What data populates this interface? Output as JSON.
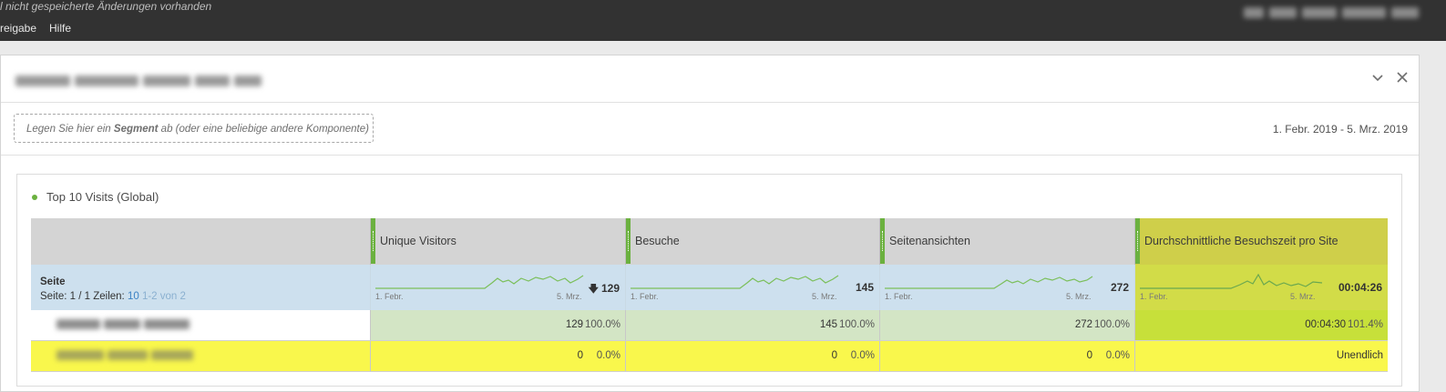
{
  "app": {
    "unsaved_notice": "l nicht gespeicherte Änderungen vorhanden",
    "menu": [
      {
        "label": "reigabe"
      },
      {
        "label": "Hilfe"
      }
    ]
  },
  "panel": {
    "collapse_icon": "chevron-down-icon",
    "close_icon": "close-icon",
    "dropzone": {
      "prefix": "Legen Sie hier ein ",
      "bold": "Segment",
      "suffix": " ab (oder eine beliebige andere Komponente)"
    },
    "date_range": "1. Febr. 2019 - 5. Mrz. 2019"
  },
  "table": {
    "title": "Top 10 Visits (Global)",
    "dimension_name": "Seite",
    "pagination": {
      "page_label": "Seite:",
      "page_value": "1 / 1",
      "rows_label": "Zeilen:",
      "rows_value": "10",
      "range": "1-2 von 2"
    },
    "spark_start": "1. Febr.",
    "spark_end": "5. Mrz.",
    "sort_icon": "arrow-down-icon",
    "metrics": [
      {
        "name": "Unique Visitors",
        "total": "129",
        "sorted": true
      },
      {
        "name": "Besuche",
        "total": "145",
        "sorted": false
      },
      {
        "name": "Seitenansichten",
        "total": "272",
        "sorted": false
      },
      {
        "name": "Durchschnittliche Besuchszeit pro Site",
        "total": "00:04:26",
        "sorted": false
      }
    ],
    "rows": [
      {
        "cells": [
          {
            "value": "129",
            "pct": "100.0%"
          },
          {
            "value": "145",
            "pct": "100.0%"
          },
          {
            "value": "272",
            "pct": "100.0%"
          },
          {
            "value": "00:04:30",
            "pct": "101.4%"
          }
        ]
      },
      {
        "cells": [
          {
            "value": "0",
            "pct": "0.0%"
          },
          {
            "value": "0",
            "pct": "0.0%"
          },
          {
            "value": "0",
            "pct": "0.0%"
          },
          {
            "value": "Unendlich",
            "pct": ""
          }
        ]
      }
    ]
  },
  "colors": {
    "accent_green": "#6bb13f",
    "highlight_yellow": "#f9f74c",
    "summary_blue": "#cde0ee",
    "row_green": "#d3e5c5"
  }
}
